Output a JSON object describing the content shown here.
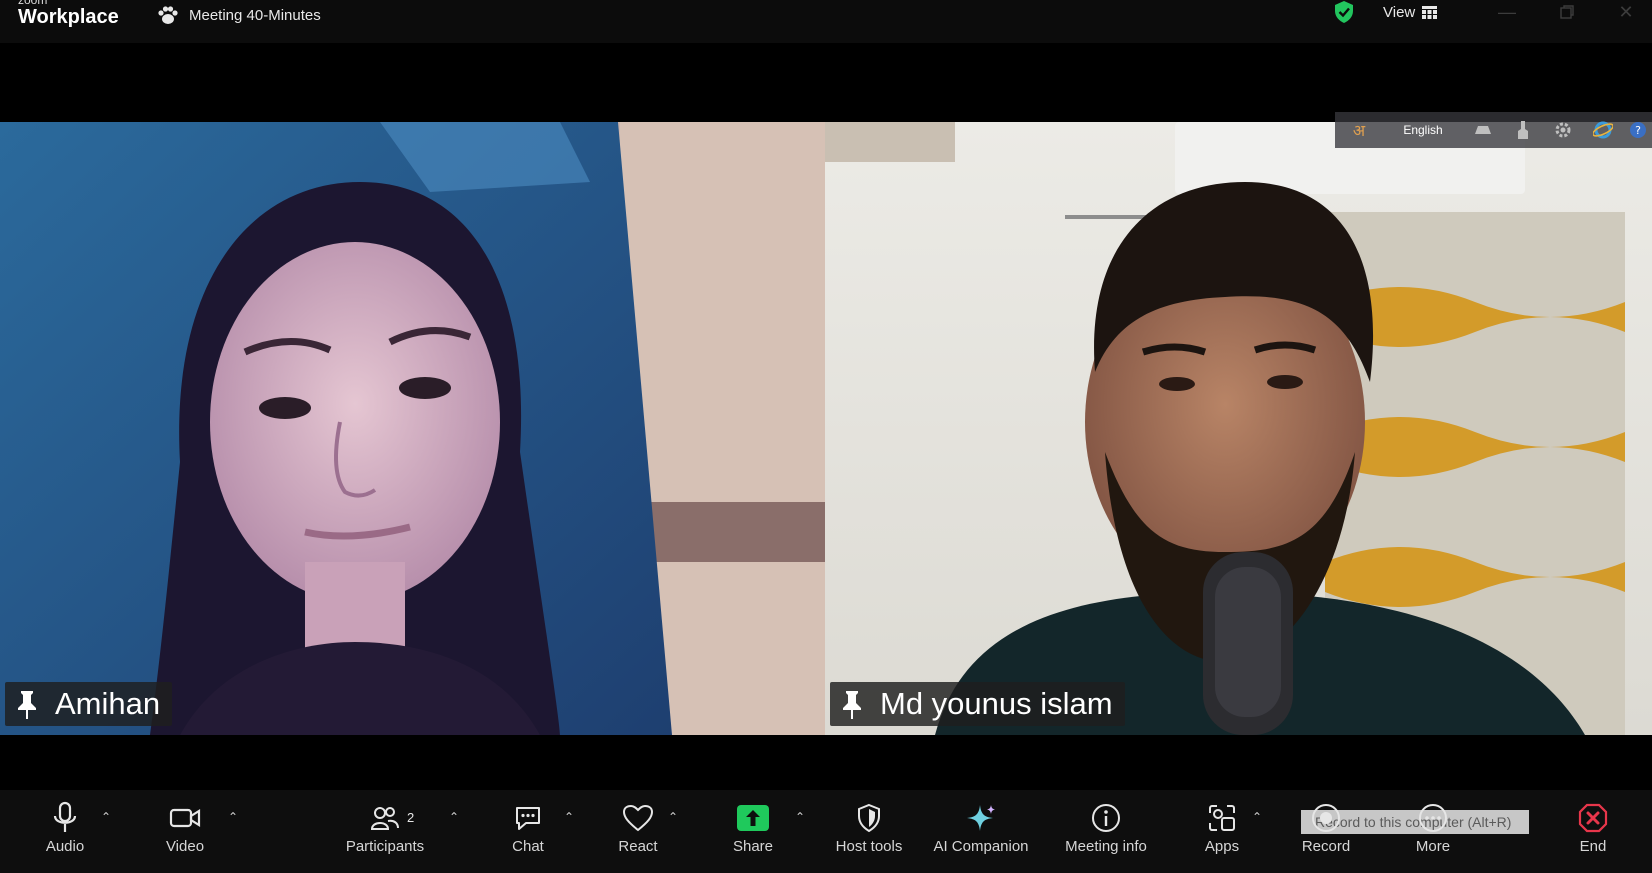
{
  "app": {
    "brand_small": "zoom",
    "brand_name": "Workplace"
  },
  "titlebar": {
    "meeting_title": "Meeting 40-Minutes",
    "view_label": "View"
  },
  "participants": [
    {
      "name": "Amihan"
    },
    {
      "name": "Md younus islam"
    }
  ],
  "language_bar": {
    "language": "English"
  },
  "toolbar": {
    "audio": "Audio",
    "video": "Video",
    "participants": "Participants",
    "participants_count": "2",
    "chat": "Chat",
    "react": "React",
    "share": "Share",
    "host_tools": "Host tools",
    "ai_companion": "AI Companion",
    "meeting_info": "Meeting info",
    "apps": "Apps",
    "record": "Record",
    "record_tooltip": "Record to this computer (Alt+R)",
    "more": "More",
    "end": "End"
  },
  "colors": {
    "share_green": "#1fc95c",
    "end_red": "#e8364b",
    "shield_green": "#22c55e"
  }
}
